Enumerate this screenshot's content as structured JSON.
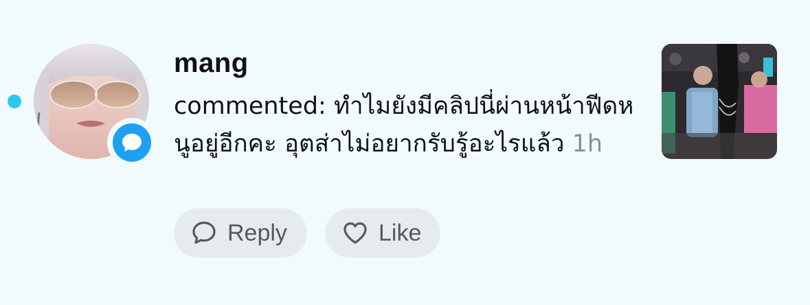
{
  "notification": {
    "username": "mang",
    "action_prefix": "commented:",
    "comment_text": "ทำไมยังมีคลิปนี่ผ่านหน้าฟีดหนูอยู่อีกคะ อุตส่าไม่อยากรับรู้อะไรแล้ว",
    "time": "1h",
    "unread": true,
    "badge_icon": "comment-bubble-icon",
    "accent_color": "#2bc7ec",
    "badge_color": "#1da1f2"
  },
  "actions": {
    "reply_label": "Reply",
    "reply_icon": "speech-bubble-icon",
    "like_label": "Like",
    "like_icon": "heart-outline-icon"
  }
}
